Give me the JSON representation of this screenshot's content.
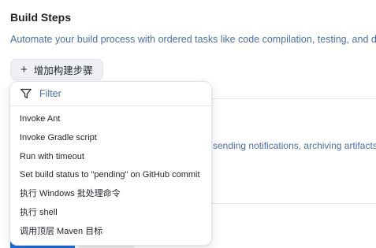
{
  "section": {
    "title": "Build Steps",
    "description": "Automate your build process with ordered tasks like code compilation, testing, and deploy"
  },
  "add_step_button": {
    "icon": "plus-icon",
    "label": "增加构建步骤"
  },
  "background": {
    "description_2": "sending notifications, archiving artifacts"
  },
  "dropdown": {
    "filter": {
      "icon": "filter-icon",
      "placeholder": "Filter",
      "value": ""
    },
    "items": [
      "Invoke Ant",
      "Invoke Gradle script",
      "Run with timeout",
      "Set build status to \"pending\" on GitHub commit",
      "执行 Windows 批处理命令",
      "执行 shell",
      "调用顶层 Maven 目标"
    ]
  },
  "colors": {
    "link_blue": "#4a6fa5",
    "primary": "#1f6fe0",
    "button_bg": "#eef0f3"
  }
}
